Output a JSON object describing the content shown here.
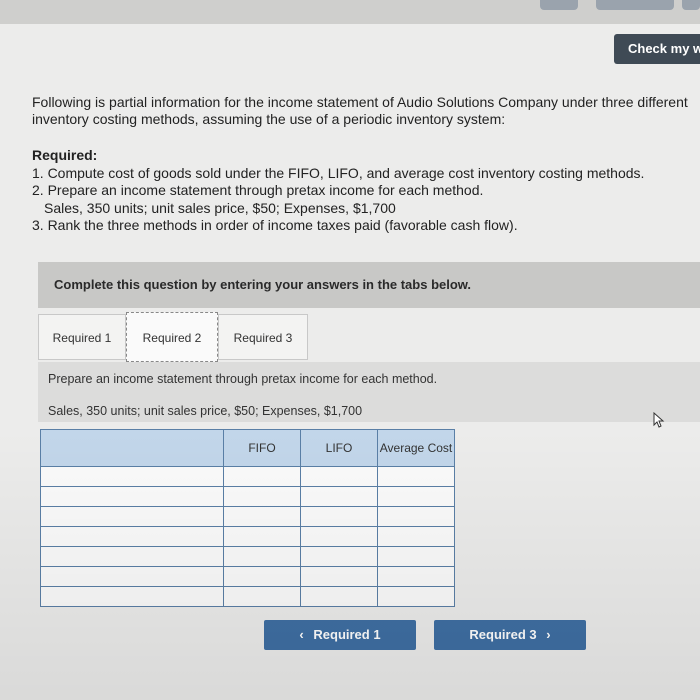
{
  "header": {
    "check_button": "Check my w"
  },
  "problem": {
    "intro": "Following is partial information for the income statement of Audio Solutions Company under three different inventory costing methods, assuming the use of a periodic inventory system:",
    "required_title": "Required:",
    "items": [
      "1. Compute cost of goods sold under the FIFO, LIFO, and average cost inventory costing methods.",
      "2. Prepare an income statement through pretax income for each method.",
      "Sales, 350 units; unit sales price, $50; Expenses, $1,700",
      "3. Rank the three methods in order of income taxes paid (favorable cash flow)."
    ]
  },
  "instruction": "Complete this question by entering your answers in the tabs below.",
  "tabs": [
    {
      "label": "Required 1"
    },
    {
      "label": "Required 2"
    },
    {
      "label": "Required 3"
    }
  ],
  "panel": {
    "line1": "Prepare an income statement through pretax income for each method.",
    "line2": "Sales, 350 units; unit sales price, $50; Expenses, $1,700"
  },
  "table": {
    "columns": [
      "",
      "FIFO",
      "LIFO",
      "Average Cost"
    ]
  },
  "nav": {
    "prev_label": "Required 1",
    "next_label": "Required 3",
    "prev_icon": "chevron-left-icon",
    "next_icon": "chevron-right-icon"
  },
  "colors": {
    "nav_button": "#3f6fa3",
    "check_button": "#3f4a55",
    "table_header": "#c2d6ea"
  }
}
